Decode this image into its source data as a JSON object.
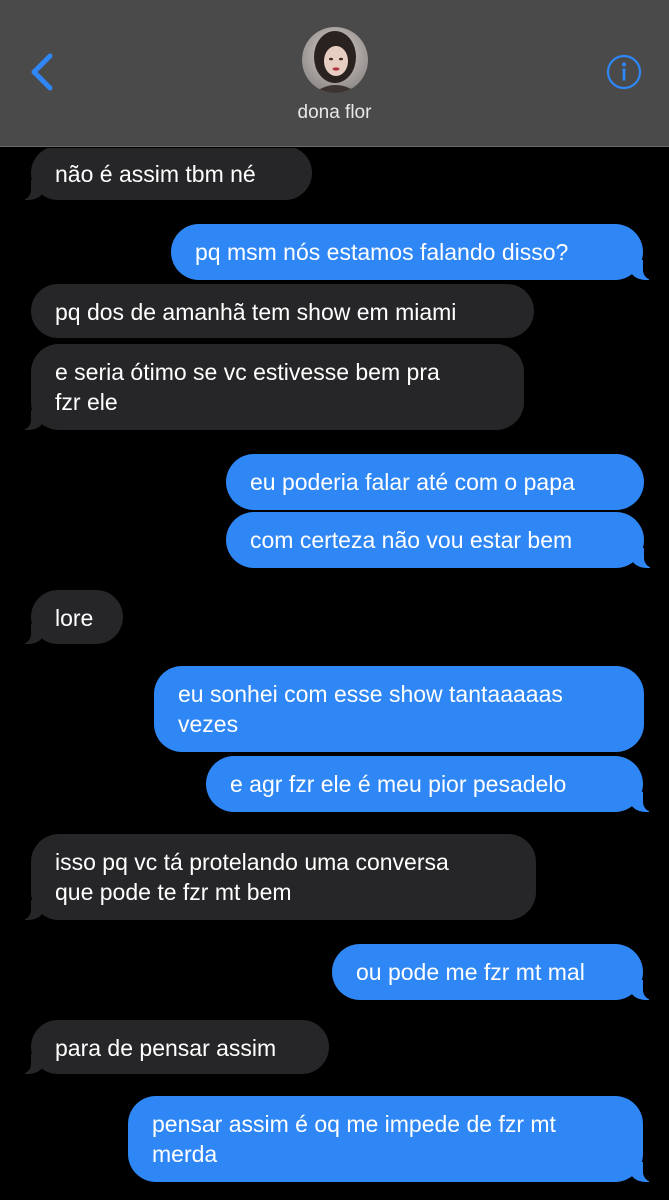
{
  "header": {
    "contact_name": "dona flor",
    "back_icon": "chevron-left-icon",
    "info_icon": "info-icon",
    "accent_color": "#2f87f6"
  },
  "messages": [
    {
      "from": "contact",
      "text": "não é assim tbm né"
    },
    {
      "from": "me",
      "text": "pq msm nós estamos falando disso?"
    },
    {
      "from": "contact",
      "text": "pq dos de amanhã tem show em miami"
    },
    {
      "from": "contact",
      "text": "e seria ótimo se vc estivesse bem pra\nfzr ele"
    },
    {
      "from": "me",
      "text": "eu poderia falar até com o papa"
    },
    {
      "from": "me",
      "text": "com certeza não vou estar bem"
    },
    {
      "from": "contact",
      "text": "lore"
    },
    {
      "from": "me",
      "text": "eu sonhei com esse show tantaaaaas\nvezes"
    },
    {
      "from": "me",
      "text": "e agr fzr ele é meu pior pesadelo"
    },
    {
      "from": "contact",
      "text": "isso pq vc tá protelando uma conversa\nque pode te fzr mt bem"
    },
    {
      "from": "me",
      "text": "ou pode me fzr mt mal"
    },
    {
      "from": "contact",
      "text": "para de pensar assim"
    },
    {
      "from": "me",
      "text": "pensar assim é oq me impede de fzr mt\nmerda"
    }
  ]
}
